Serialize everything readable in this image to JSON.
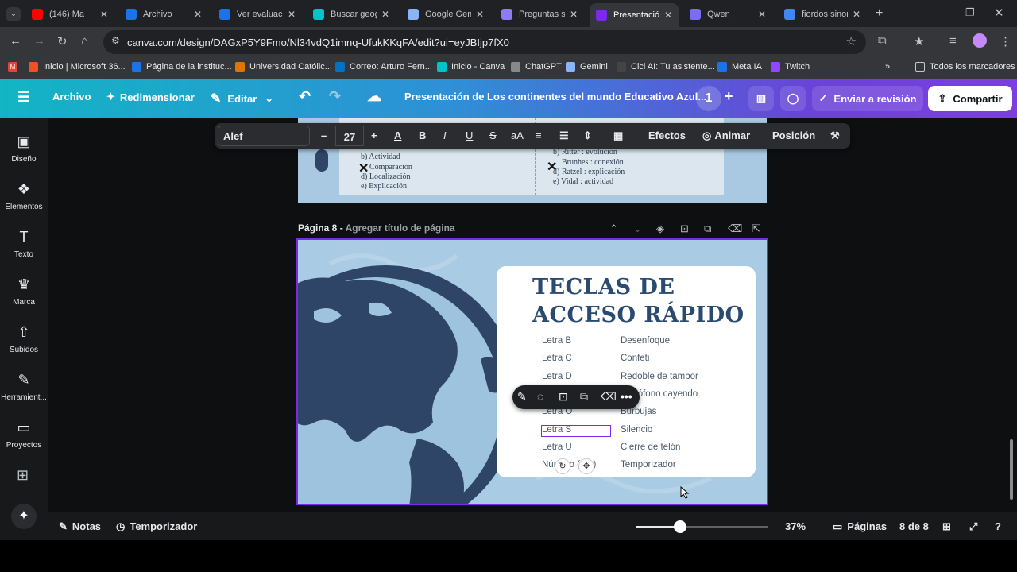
{
  "browser": {
    "tabs": [
      {
        "title": "(146) Ma",
        "icon": "youtube-icon",
        "color": "#ff0000"
      },
      {
        "title": "Archivo",
        "icon": "archivo-icon",
        "color": "#1a73e8"
      },
      {
        "title": "Ver evaluació",
        "icon": "doc-icon",
        "color": "#1a73e8"
      },
      {
        "title": "Buscar geogr",
        "icon": "canva-icon",
        "color": "#00c4cc"
      },
      {
        "title": "Google Gemi",
        "icon": "gemini-icon",
        "color": "#8ab4f8"
      },
      {
        "title": "Preguntas so",
        "icon": "claude-icon",
        "color": "#8e7cf0"
      },
      {
        "title": "Presentación",
        "icon": "canva-icon",
        "color": "#7d2ae8"
      },
      {
        "title": "Qwen",
        "icon": "qwen-icon",
        "color": "#7c6cf0"
      },
      {
        "title": "fiordos sinon",
        "icon": "google-icon",
        "color": "#4285f4"
      }
    ],
    "url": "canva.com/design/DAGxP5Y9Fmo/Nl34vdQ1imnq-UfukKKqFA/edit?ui=eyJBIjp7fX0",
    "bookmarks": [
      "Inicio | Microsoft 36...",
      "Página de la instituc...",
      "Universidad Católic...",
      "Correo: Arturo Fern...",
      "Inicio - Canva",
      "ChatGPT",
      "Gemini",
      "Cici AI: Tu asistente...",
      "Meta IA",
      "Twitch"
    ],
    "all_bookmarks": "Todos los marcadores"
  },
  "canva": {
    "menu": "Archivo",
    "resize": "Redimensionar",
    "edit": "Editar",
    "doc_title": "Presentación de Los continentes del mundo Educativo Azul...",
    "collab_count": "1",
    "send_review": "Enviar a revisión",
    "share": "Compartir"
  },
  "sidebar": [
    {
      "label": "Diseño",
      "icon": "layout-icon"
    },
    {
      "label": "Elementos",
      "icon": "elements-icon"
    },
    {
      "label": "Texto",
      "icon": "text-icon"
    },
    {
      "label": "Marca",
      "icon": "brand-icon"
    },
    {
      "label": "Subidos",
      "icon": "upload-icon"
    },
    {
      "label": "Herramient...",
      "icon": "tools-icon"
    },
    {
      "label": "Proyectos",
      "icon": "folder-icon"
    }
  ],
  "toolbar": {
    "font": "Alef",
    "size": "27",
    "effects": "Efectos",
    "animate": "Animar",
    "position": "Posición"
  },
  "prev_page": {
    "left_items": [
      "b) Actividad",
      "Comparación",
      "d) Localización",
      "e) Explicación"
    ],
    "right_items": [
      "b) Ritter : evolución",
      "Brunhes : conexión",
      "d) Ratzel : explicación",
      "e) Vidal : actividad"
    ]
  },
  "page": {
    "label": "Página 8 -",
    "placeholder": "Agregar título de página"
  },
  "slide": {
    "title_line1": "TECLAS DE",
    "title_line2": "ACCESO RÁPIDO",
    "rows": [
      {
        "key": "Letra B",
        "effect": "Desenfoque"
      },
      {
        "key": "Letra C",
        "effect": "Confeti"
      },
      {
        "key": "Letra D",
        "effect": "Redoble de tambor"
      },
      {
        "key": "",
        "effect": "micrófono cayendo"
      },
      {
        "key": "Letra O",
        "effect": "Burbujas"
      },
      {
        "key": "Letra S",
        "effect": "Silencio"
      },
      {
        "key": "Letra U",
        "effect": "Cierre de telón"
      },
      {
        "key": "Número (0-9)",
        "effect": "Temporizador"
      }
    ],
    "colors": {
      "ocean": "#a9cbe4",
      "land": "#2e4568",
      "title": "#2b4a6f"
    }
  },
  "bottom": {
    "notes": "Notas",
    "timer": "Temporizador",
    "zoom": "37%",
    "zoom_fraction": 0.34,
    "pages_label": "Páginas",
    "page_count": "8 de 8"
  }
}
